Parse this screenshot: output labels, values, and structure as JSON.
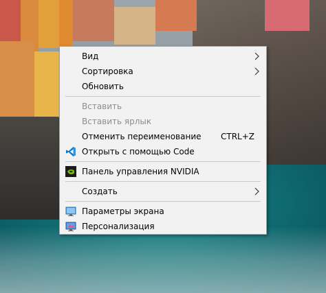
{
  "context_menu": {
    "items": [
      {
        "label": "Вид",
        "submenu": true,
        "enabled": true
      },
      {
        "label": "Сортировка",
        "submenu": true,
        "enabled": true
      },
      {
        "label": "Обновить",
        "enabled": true
      },
      {
        "label": "Вставить",
        "enabled": false
      },
      {
        "label": "Вставить ярлык",
        "enabled": false
      },
      {
        "label": "Отменить переименование",
        "shortcut": "CTRL+Z",
        "enabled": true
      },
      {
        "label": "Открыть с помощью Code",
        "icon": "vscode-icon",
        "enabled": true
      },
      {
        "label": "Панель управления NVIDIA",
        "icon": "nvidia-icon",
        "enabled": true
      },
      {
        "label": "Создать",
        "submenu": true,
        "enabled": true
      },
      {
        "label": "Параметры экрана",
        "icon": "display-settings-icon",
        "enabled": true
      },
      {
        "label": "Персонализация",
        "icon": "personalization-icon",
        "enabled": true
      }
    ]
  },
  "colors": {
    "menu_background": "#f2f2f2",
    "disabled_text": "#8d8d8d",
    "separator": "#c8c8c8",
    "vscode_blue": "#0a7ad1",
    "nvidia_green": "#76b900"
  }
}
